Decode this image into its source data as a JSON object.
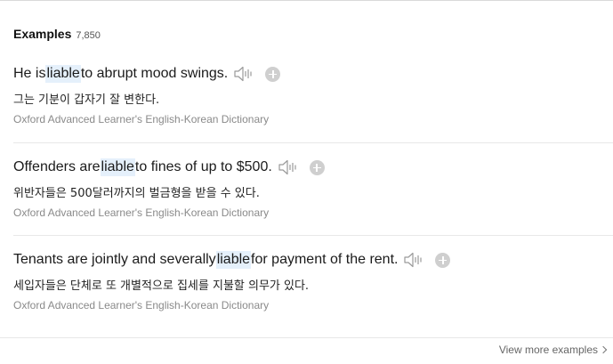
{
  "header": {
    "title": "Examples",
    "count": "7,850"
  },
  "examples": [
    {
      "en_before": "He is ",
      "keyword": "liable",
      "en_after": " to abrupt mood swings.",
      "ko": "그는 기분이 갑자기 잘 변한다.",
      "source": "Oxford Advanced Learner's English-Korean Dictionary"
    },
    {
      "en_before": "Offenders are ",
      "keyword": "liable",
      "en_after": " to fines of up to $500.",
      "ko": "위반자들은 500달러까지의 벌금형을 받을 수 있다.",
      "source": "Oxford Advanced Learner's English-Korean Dictionary"
    },
    {
      "en_before": "Tenants are jointly and severally ",
      "keyword": "liable",
      "en_after": " for payment of the rent.",
      "ko": "세입자들은 단체로 또 개별적으로 집세를 지불할 의무가 있다.",
      "source": "Oxford Advanced Learner's English-Korean Dictionary"
    }
  ],
  "icons": {
    "speaker": "speaker-icon",
    "add": "plus-circle-icon",
    "chevron": "chevron-right-icon"
  },
  "colors": {
    "keyword_highlight": "#e5f0fb",
    "source_text": "#8a8a8a",
    "add_button": "#cfcfcf"
  },
  "footer": {
    "view_more_label": "View more examples"
  }
}
